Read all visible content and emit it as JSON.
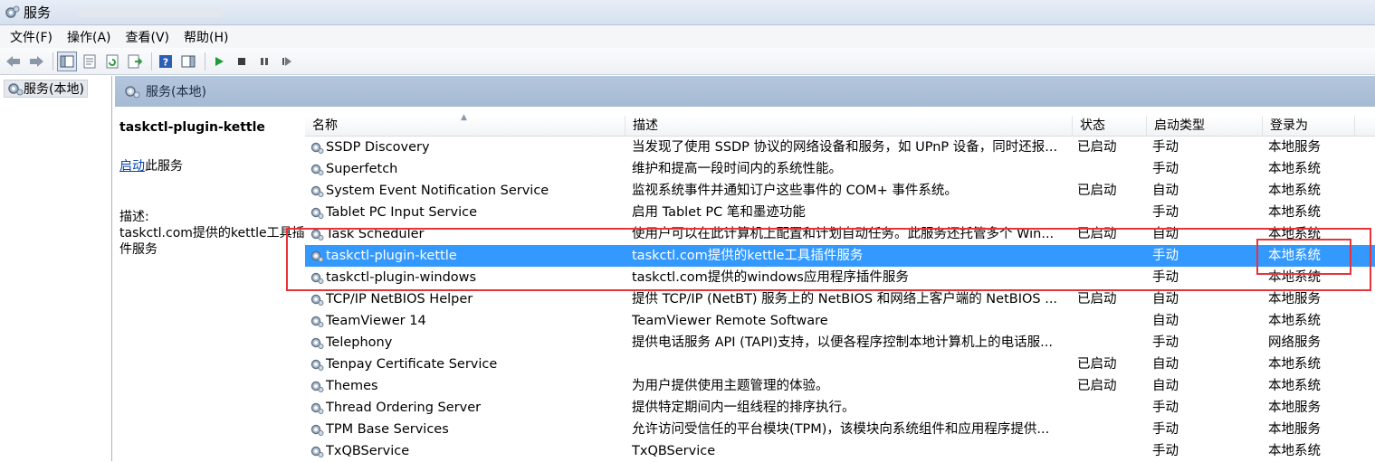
{
  "window": {
    "title": "服务"
  },
  "menu": [
    {
      "label": "文件(F)"
    },
    {
      "label": "操作(A)"
    },
    {
      "label": "查看(V)"
    },
    {
      "label": "帮助(H)"
    }
  ],
  "tree": {
    "root_label": "服务(本地)"
  },
  "header": {
    "title": "服务(本地)"
  },
  "details": {
    "service_name": "taskctl-plugin-kettle",
    "start_link": "启动",
    "start_suffix": "此服务",
    "desc_label": "描述:",
    "desc_text": "taskctl.com提供的kettle工具插件服务"
  },
  "columns": {
    "name": "名称",
    "desc": "描述",
    "status": "状态",
    "startup": "启动类型",
    "logon": "登录为"
  },
  "rows": [
    {
      "name": "SSDP Discovery",
      "desc": "当发现了使用 SSDP 协议的网络设备和服务，如 UPnP 设备，同时还报...",
      "status": "已启动",
      "startup": "手动",
      "logon": "本地服务"
    },
    {
      "name": "Superfetch",
      "desc": "维护和提高一段时间内的系统性能。",
      "status": "",
      "startup": "手动",
      "logon": "本地系统"
    },
    {
      "name": "System Event Notification Service",
      "desc": "监视系统事件并通知订户这些事件的 COM+ 事件系统。",
      "status": "已启动",
      "startup": "自动",
      "logon": "本地系统"
    },
    {
      "name": "Tablet PC Input Service",
      "desc": "启用 Tablet PC 笔和墨迹功能",
      "status": "",
      "startup": "手动",
      "logon": "本地系统"
    },
    {
      "name": "Task Scheduler",
      "desc": "使用户可以在此计算机上配置和计划自动任务。此服务还托管多个 Win...",
      "status": "已启动",
      "startup": "自动",
      "logon": "本地系统"
    },
    {
      "name": "taskctl-plugin-kettle",
      "desc": "taskctl.com提供的kettle工具插件服务",
      "status": "",
      "startup": "手动",
      "logon": "本地系统"
    },
    {
      "name": "taskctl-plugin-windows",
      "desc": "taskctl.com提供的windows应用程序插件服务",
      "status": "",
      "startup": "手动",
      "logon": "本地系统"
    },
    {
      "name": "TCP/IP NetBIOS Helper",
      "desc": "提供 TCP/IP (NetBT) 服务上的 NetBIOS 和网络上客户端的 NetBIOS ...",
      "status": "已启动",
      "startup": "自动",
      "logon": "本地服务"
    },
    {
      "name": "TeamViewer 14",
      "desc": "TeamViewer Remote Software",
      "status": "",
      "startup": "自动",
      "logon": "本地系统"
    },
    {
      "name": "Telephony",
      "desc": "提供电话服务 API (TAPI)支持，以便各程序控制本地计算机上的电话服...",
      "status": "",
      "startup": "手动",
      "logon": "网络服务"
    },
    {
      "name": "Tenpay Certificate Service",
      "desc": "",
      "status": "已启动",
      "startup": "自动",
      "logon": "本地系统"
    },
    {
      "name": "Themes",
      "desc": "为用户提供使用主题管理的体验。",
      "status": "已启动",
      "startup": "自动",
      "logon": "本地系统"
    },
    {
      "name": "Thread Ordering Server",
      "desc": "提供特定期间内一组线程的排序执行。",
      "status": "",
      "startup": "手动",
      "logon": "本地服务"
    },
    {
      "name": "TPM Base Services",
      "desc": "允许访问受信任的平台模块(TPM)，该模块向系统组件和应用程序提供...",
      "status": "",
      "startup": "手动",
      "logon": "本地服务"
    },
    {
      "name": "TxQBService",
      "desc": "TxQBService",
      "status": "",
      "startup": "手动",
      "logon": "本地系统"
    }
  ],
  "selected_index": 5,
  "colors": {
    "selection": "#3399ff",
    "annotation": "#e8333a",
    "header_band": "#a9bdd6"
  }
}
